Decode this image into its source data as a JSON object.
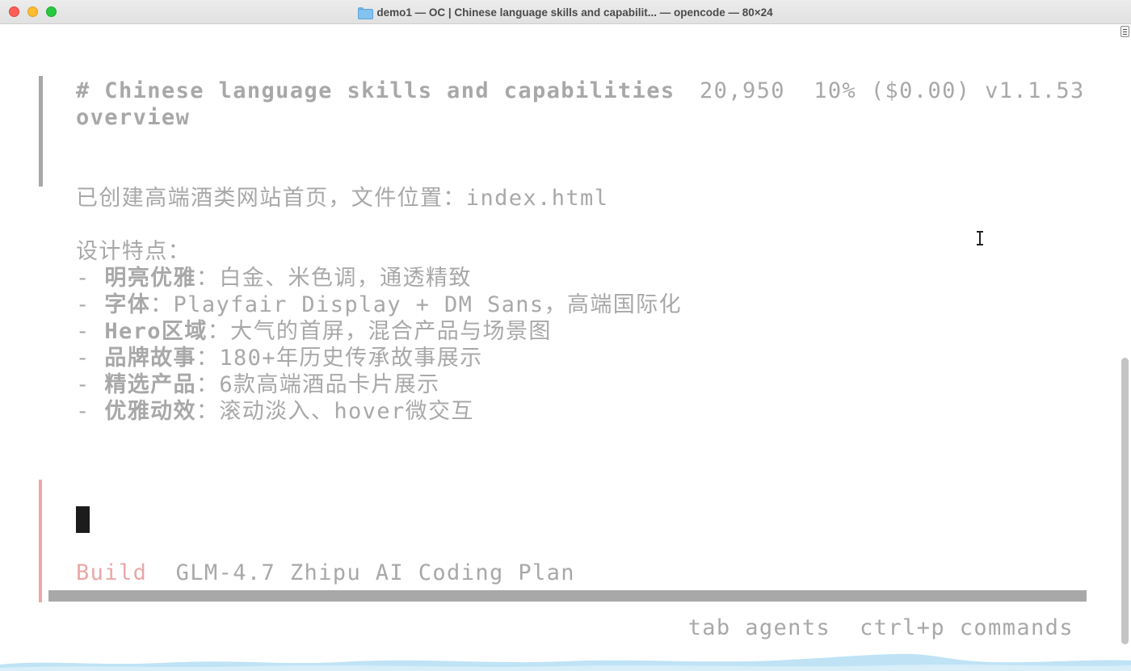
{
  "window": {
    "title": "demo1 — OC | Chinese language skills and capabilit... — opencode — 80×24"
  },
  "session": {
    "title_line1": "# Chinese language skills and capabilities",
    "title_line2": "overview",
    "tokens": "20,950",
    "context_usage": "10%",
    "cost": "($0.00)",
    "version": "v1.1.53"
  },
  "response": {
    "intro": "已创建高端酒类网站首页，文件位置：index.html",
    "features_heading": "设计特点：",
    "bullet_prefix": "- ",
    "features": [
      {
        "label": "明亮优雅",
        "text": "：白金、米色调，通透精致"
      },
      {
        "label": "字体",
        "text": "：Playfair Display + DM Sans，高端国际化"
      },
      {
        "label": "Hero区域",
        "text": "：大气的首屏，混合产品与场景图"
      },
      {
        "label": "品牌故事",
        "text": "：180+年历史传承故事展示"
      },
      {
        "label": "精选产品",
        "text": "：6款高端酒品卡片展示"
      },
      {
        "label": "优雅动效",
        "text": "：滚动淡入、hover微交互"
      }
    ]
  },
  "prompt": {
    "mode": "Build",
    "model": "GLM-4.7 Zhipu AI Coding Plan"
  },
  "hints": {
    "agents": "tab agents",
    "commands": "ctrl+p commands"
  }
}
